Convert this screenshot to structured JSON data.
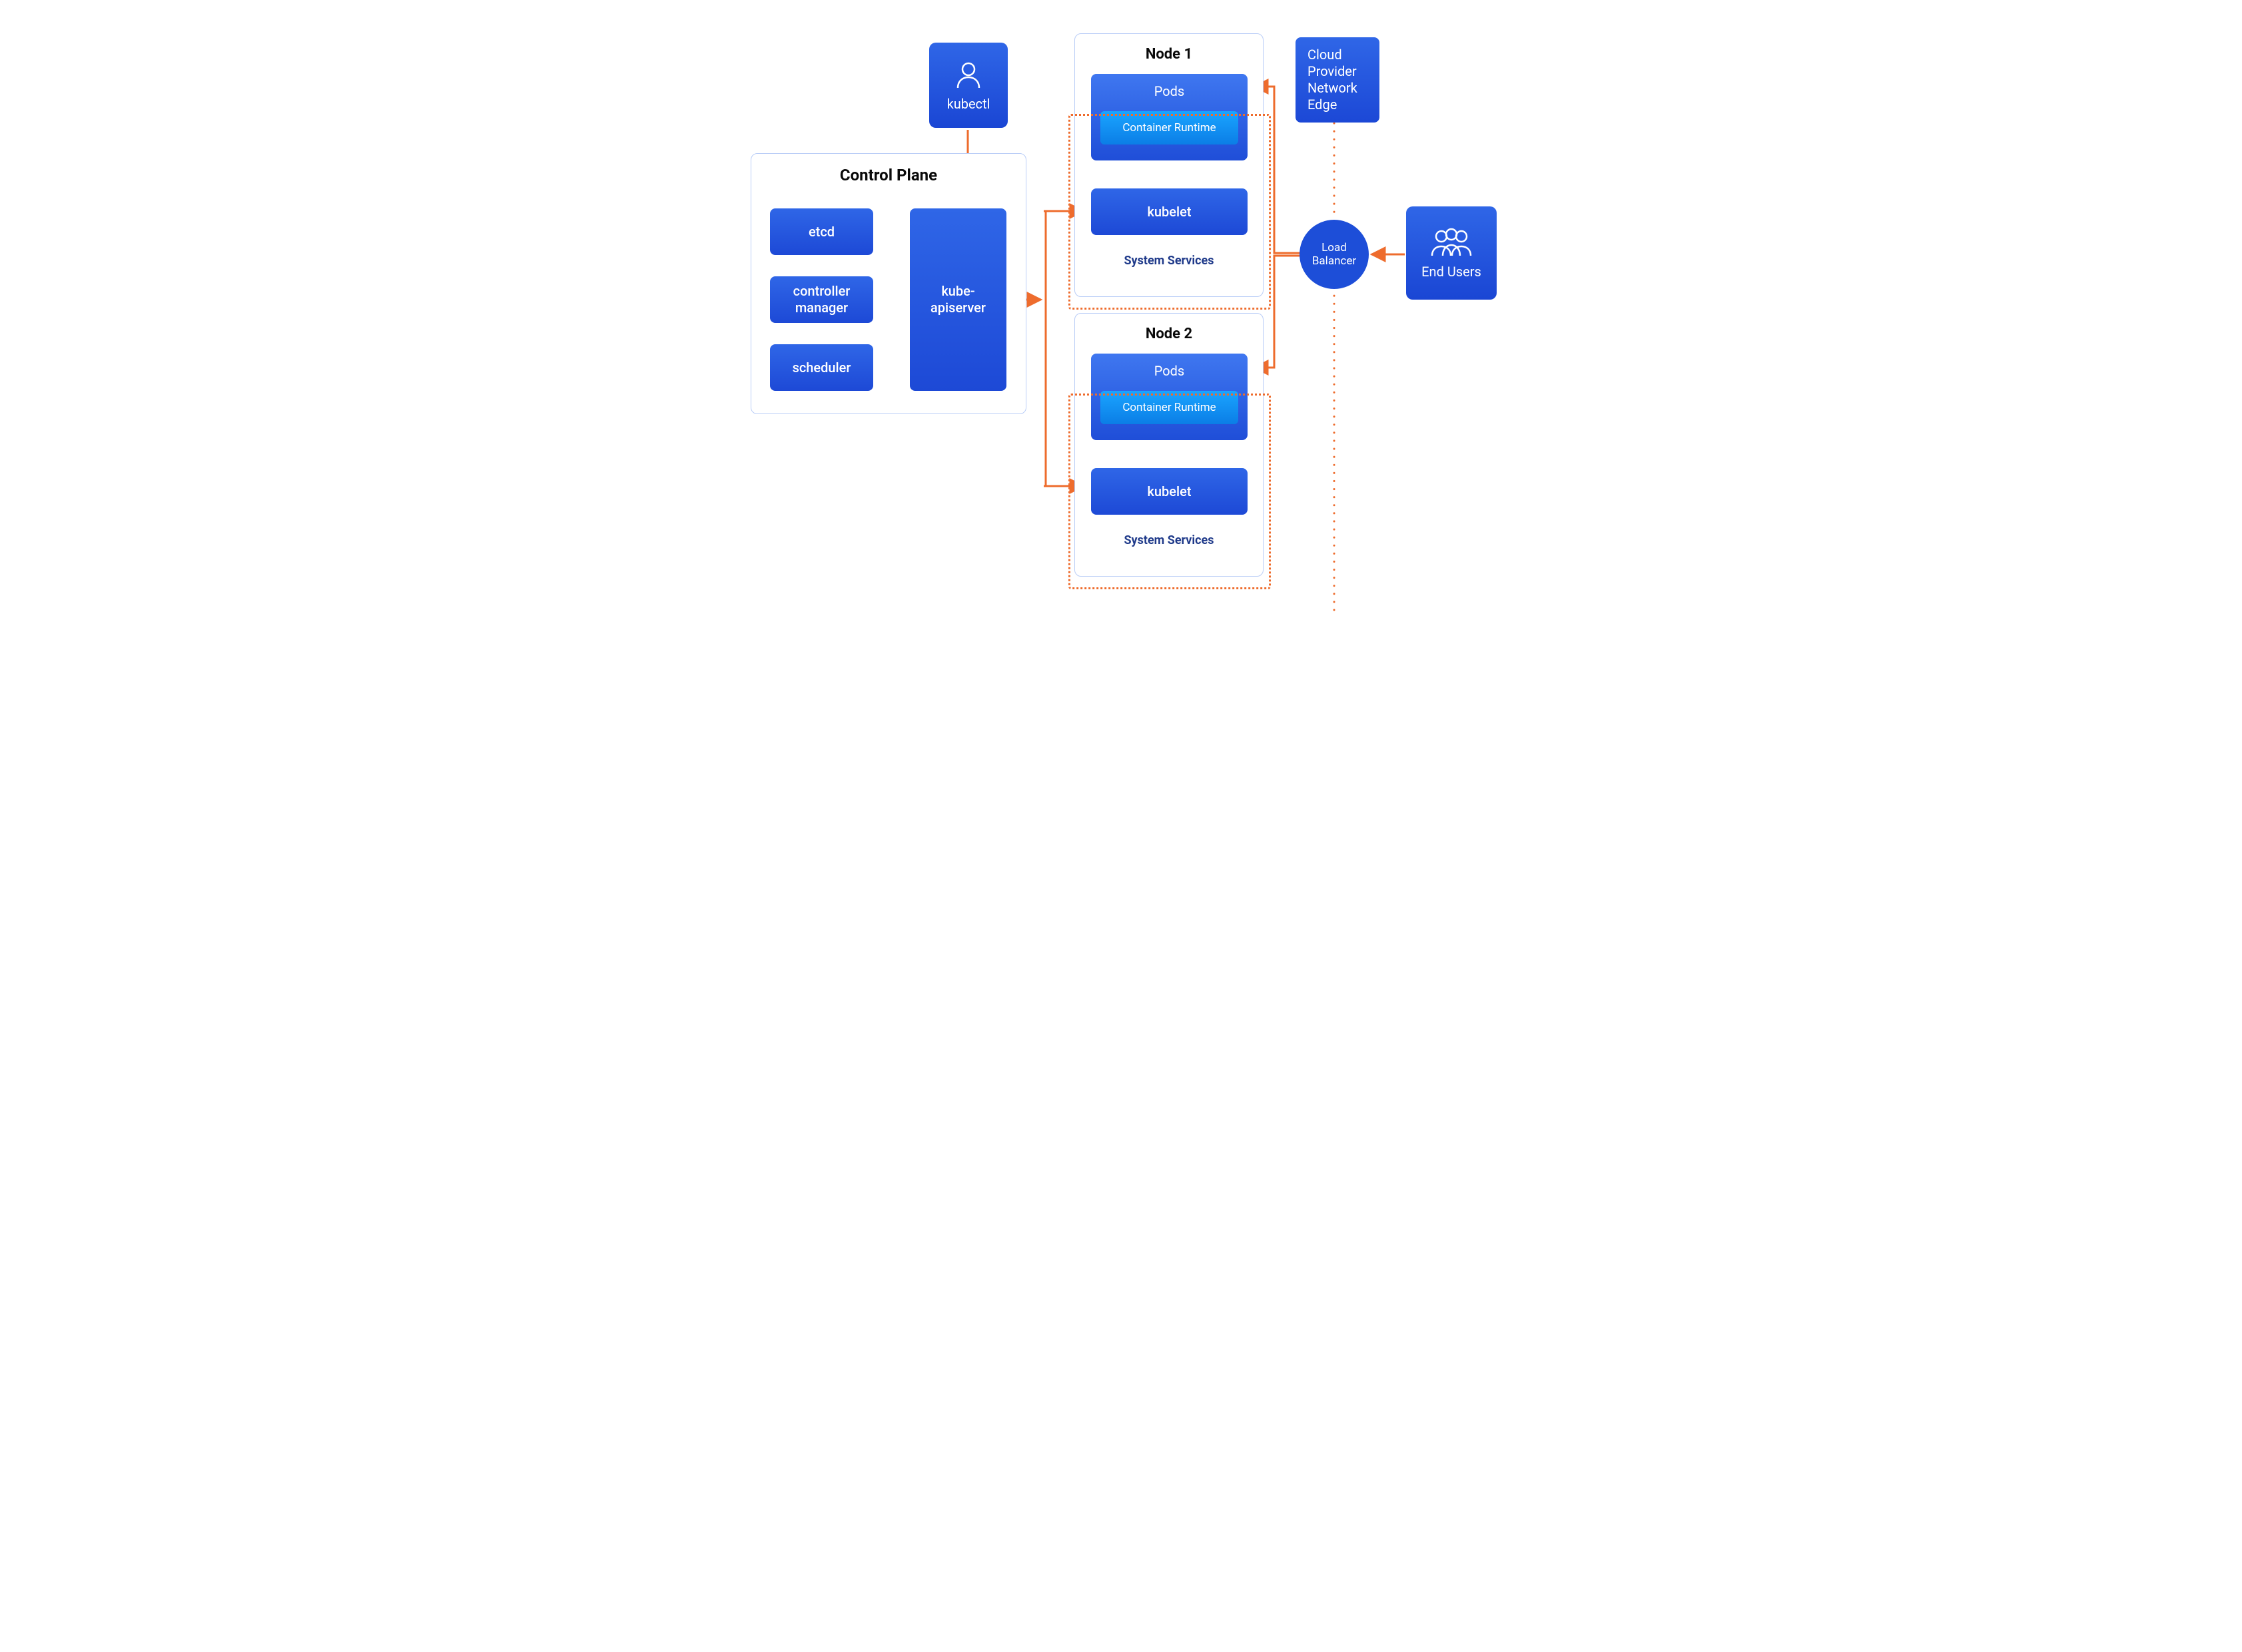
{
  "colors": {
    "box_border": "#b9cdf7",
    "card_gradient_top": "#2f66e7",
    "card_gradient_bottom": "#1d49d6",
    "runtime_top": "#1aa4ff",
    "runtime_bottom": "#0b7ee6",
    "arrow": "#ee6c2d",
    "sys_services_text": "#1f3a8a",
    "title_text": "#0a0a0a"
  },
  "kubectl": {
    "label": "kubectl",
    "icon": "user-icon"
  },
  "control_plane": {
    "title": "Control Plane",
    "etcd": "etcd",
    "controller_manager": "controller\nmanager",
    "scheduler": "scheduler",
    "apiserver": "kube-\napiserver"
  },
  "nodes": [
    {
      "title": "Node 1",
      "pods": "Pods",
      "container_runtime": "Container Runtime",
      "kubelet": "kubelet",
      "system_services": "System Services"
    },
    {
      "title": "Node 2",
      "pods": "Pods",
      "container_runtime": "Container Runtime",
      "kubelet": "kubelet",
      "system_services": "System Services"
    }
  ],
  "cloud_edge": {
    "label": "Cloud\nProvider\nNetwork\nEdge"
  },
  "load_balancer": {
    "label": "Load\nBalancer"
  },
  "end_users": {
    "label": "End Users",
    "icon": "users-icon"
  },
  "connections": [
    {
      "from": "kubectl",
      "to": "kube-apiserver",
      "type": "uni"
    },
    {
      "from": "etcd",
      "to": "kube-apiserver",
      "type": "bi"
    },
    {
      "from": "controller-manager",
      "to": "kube-apiserver",
      "type": "bi"
    },
    {
      "from": "scheduler",
      "to": "kube-apiserver",
      "type": "bi"
    },
    {
      "from": "kube-apiserver",
      "to": "node-1-kubelet",
      "type": "bi"
    },
    {
      "from": "kube-apiserver",
      "to": "node-2-kubelet",
      "type": "bi"
    },
    {
      "from": "load-balancer",
      "to": "node-1-pods",
      "type": "uni"
    },
    {
      "from": "load-balancer",
      "to": "node-2-pods",
      "type": "uni"
    },
    {
      "from": "end-users",
      "to": "load-balancer",
      "type": "uni"
    },
    {
      "from": "cloud-edge",
      "to": "load-balancer",
      "type": "dotted"
    },
    {
      "from": "load-balancer",
      "to": "bottom",
      "type": "dotted"
    }
  ]
}
